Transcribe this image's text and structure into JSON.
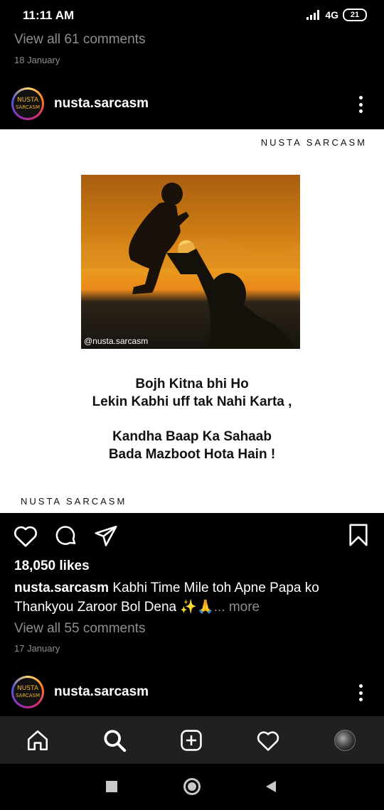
{
  "status_bar": {
    "time": "11:11 AM",
    "network": "4G",
    "battery": "21"
  },
  "previous_post": {
    "view_comments": "View all 61 comments",
    "date": "18 January"
  },
  "post": {
    "username": "nusta.sarcasm",
    "avatar_text_line1": "NUSTA",
    "avatar_text_line2": "SARCASM",
    "image": {
      "brand_top": "NUSTA SARCASM",
      "brand_bottom": "NUSTA SARCASM",
      "watermark": "@nusta.sarcasm",
      "quote_line1": "Bojh Kitna bhi Ho",
      "quote_line2": "Lekin Kabhi uff tak Nahi Karta ,",
      "quote_line3": "Kandha Baap Ka Sahaab",
      "quote_line4": "Bada Mazboot Hota Hain !"
    },
    "likes": "18,050 likes",
    "caption_username": "nusta.sarcasm",
    "caption_text": " Kabhi Time Mile toh Apne Papa ko Thankyou Zaroor Bol Dena ✨🙏",
    "caption_more": "... more",
    "view_comments": "View all 55 comments",
    "date": "17 January"
  },
  "next_post": {
    "username": "nusta.sarcasm",
    "avatar_text_line1": "NUSTA",
    "avatar_text_line2": "SARCASM"
  },
  "bottom_nav": {
    "items": [
      "home-icon",
      "search-icon",
      "add-post-icon",
      "activity-heart-icon",
      "profile-avatar"
    ]
  },
  "system_nav": {
    "items": [
      "recents-square-icon",
      "home-circle-icon",
      "back-triangle-icon"
    ]
  },
  "colors": {
    "background": "#000000",
    "muted_text": "#8e8e8e",
    "nav_bar": "#202020",
    "avatar_text": "#f2b233"
  }
}
